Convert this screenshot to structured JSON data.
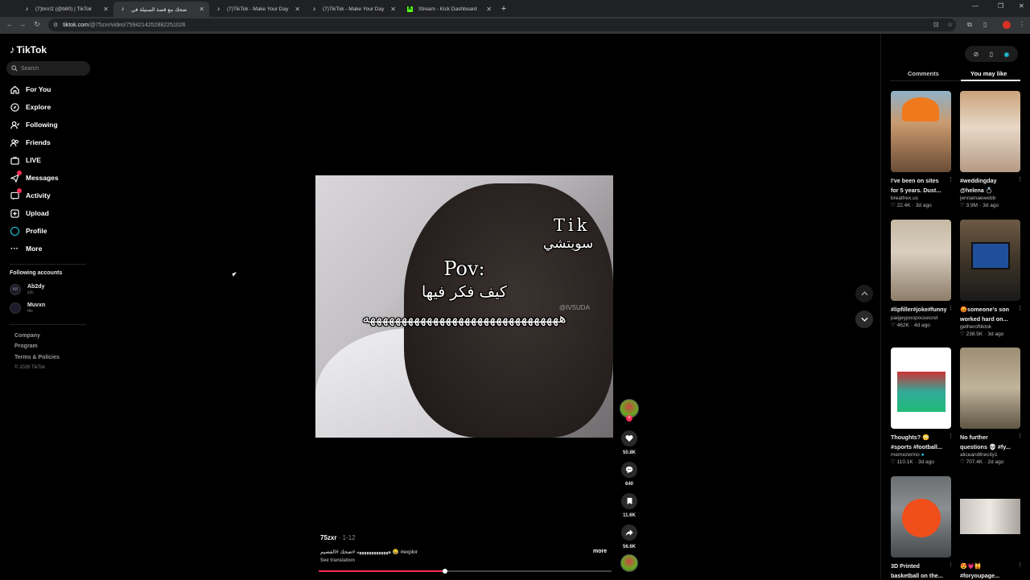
{
  "browser": {
    "tabs": [
      {
        "label": "(7)bro!2 (@b80) | TikTok",
        "active": false,
        "icon": "tiktok-favicon"
      },
      {
        "label": "ضحك مع قصة السنيلة في",
        "active": true,
        "icon": "tiktok-favicon"
      },
      {
        "label": "(7)TikTok - Make Your Day",
        "active": false,
        "icon": "tiktok-favicon"
      },
      {
        "label": "(7)TikTok - Make Your Day",
        "active": false,
        "icon": "tiktok-favicon"
      },
      {
        "label": "Stream - Kick Dashboard",
        "active": false,
        "icon": "kick-favicon"
      }
    ],
    "url_host": "tiktok.com",
    "url_path": "/@75zxr/video/7594214252882251026"
  },
  "sidebar": {
    "logo": "TikTok",
    "search_placeholder": "Search",
    "nav": [
      {
        "label": "For You",
        "icon": "home-icon"
      },
      {
        "label": "Explore",
        "icon": "compass-icon"
      },
      {
        "label": "Following",
        "icon": "following-icon"
      },
      {
        "label": "Friends",
        "icon": "friends-icon"
      },
      {
        "label": "LIVE",
        "icon": "live-icon"
      },
      {
        "label": "Messages",
        "icon": "messages-icon",
        "badge": true
      },
      {
        "label": "Activity",
        "icon": "activity-icon",
        "badge": true
      },
      {
        "label": "Upload",
        "icon": "upload-icon"
      },
      {
        "label": "Profile",
        "icon": "profile-icon"
      },
      {
        "label": "More",
        "icon": "more-icon"
      }
    ],
    "following_header": "Following accounts",
    "accounts": [
      {
        "name": "Ab2dy",
        "sub": "s2c",
        "initials": "AB"
      },
      {
        "name": "Muvxn",
        "sub": "i4o",
        "initials": ""
      }
    ],
    "footer": [
      "Company",
      "Program",
      "Terms & Policies"
    ],
    "copyright": "© 2026 TikTok"
  },
  "video": {
    "overlay_tik": "Tik",
    "overlay_sw": "سويتشي",
    "overlay_pov": "Pov:",
    "overlay_line1": "كيف فكر فيها",
    "overlay_line2": "هههههههههههههههههههههههههههههههه",
    "watermark": "@IVSUDA",
    "author": "75zxr",
    "date": " · 1-12",
    "caption": "هههههههههههههه #ضحك #القصيم 😂 #explor",
    "more": "more",
    "see_translation": "See translation",
    "progress": 0.43
  },
  "actions": {
    "likes": "50.8K",
    "comments": "640",
    "saves": "11.6K",
    "shares": "56.6K"
  },
  "panel": {
    "tab_comments": "Comments",
    "tab_you_may_like": "You may like",
    "cards": [
      {
        "title": "I've been on sites for 5 years. Dust...",
        "author": "breathex.us",
        "likes": "22.4K",
        "age": "3d ago",
        "thumb": "t1"
      },
      {
        "title": "#weddingday @helena 💍",
        "author": "jennamaewebb",
        "likes": "3.9M",
        "age": "3d ago",
        "thumb": "t2"
      },
      {
        "title": "#lipfiller#joke#funny",
        "author": "paigeypoopoosecret",
        "likes": "462K",
        "age": "4d ago",
        "thumb": "t3"
      },
      {
        "title": "😡someone's son worked hard on...",
        "author": "getheroftiktok",
        "likes": "238.5K",
        "age": "3d ago",
        "thumb": "t4"
      },
      {
        "title": "Thoughts? 😳 #sports #football...",
        "author": "memezerino",
        "likes": "110.1K",
        "age": "3d ago",
        "thumb": "t5"
      },
      {
        "title": "No further questions 💀 #fy...",
        "author": "aliceandthecity1",
        "likes": "707.4K",
        "age": "2d ago",
        "thumb": "t6"
      },
      {
        "title": "3D Printed basketball on the...",
        "author": "",
        "likes": "",
        "age": "",
        "thumb": "t7"
      },
      {
        "title": "😍💗🙀 #foryoupage...",
        "author": "",
        "likes": "",
        "age": "",
        "thumb": "t8"
      }
    ]
  }
}
